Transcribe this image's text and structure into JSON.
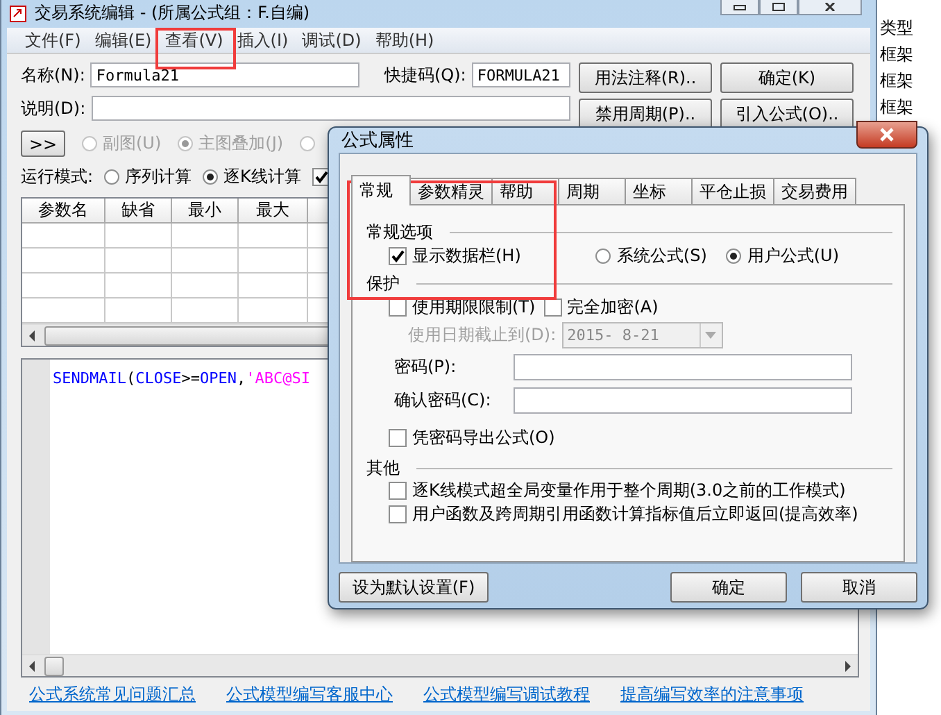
{
  "window": {
    "title": "交易系统编辑 - (所属公式组：F.自编)"
  },
  "menu": [
    {
      "label": "文件(F)"
    },
    {
      "label": "编辑(E)"
    },
    {
      "label": "查看(V)"
    },
    {
      "label": "插入(I)"
    },
    {
      "label": "调试(D)"
    },
    {
      "label": "帮助(H)"
    }
  ],
  "form": {
    "name_label": "名称(N):",
    "name_value": "Formula21",
    "shortcut_label": "快捷码(Q):",
    "shortcut_value": "FORMULA21",
    "desc_label": "说明(D):",
    "buttons": [
      {
        "label": "用法注释(R).."
      },
      {
        "label": "确定(K)"
      },
      {
        "label": "禁用周期(P).."
      },
      {
        "label": "引入公式(O).."
      }
    ]
  },
  "expand_button": ">>",
  "chart_options": [
    {
      "label": "副图(U)",
      "selected": false,
      "disabled": true
    },
    {
      "label": "主图叠加(J)",
      "selected": true,
      "disabled": true
    },
    {
      "selected": false,
      "disabled": true
    }
  ],
  "run_mode": {
    "label": "运行模式:",
    "options": [
      {
        "label": "序列计算",
        "selected": false
      },
      {
        "label": "逐K线计算",
        "selected": true
      }
    ],
    "checkbox": {
      "checked": true
    }
  },
  "params_table": {
    "columns": [
      "参数名",
      "缺省",
      "最小",
      "最大"
    ]
  },
  "editor": {
    "tokens": [
      {
        "text": "SENDMAIL",
        "color": "#0000ff"
      },
      {
        "text": "(",
        "color": "#000000"
      },
      {
        "text": "CLOSE",
        "color": "#0000ff"
      },
      {
        "text": ">=",
        "color": "#000000"
      },
      {
        "text": "OPEN",
        "color": "#0000ff"
      },
      {
        "text": ",",
        "color": "#000000"
      },
      {
        "text": "'ABC@SI",
        "color": "#ff00ff"
      }
    ]
  },
  "links": [
    "公式系统常见问题汇总",
    "公式模型编写客服中心",
    "公式模型编写调试教程",
    "提高编写效率的注意事项"
  ],
  "background_list": {
    "header": "类型",
    "rows": [
      "框架",
      "框架",
      "框架"
    ]
  },
  "dialog": {
    "title": "公式属性",
    "tabs": [
      {
        "label": "常规",
        "selected": true
      },
      {
        "label": "参数精灵",
        "selected": false
      },
      {
        "label": "帮助",
        "selected": false
      },
      {
        "label": "周期",
        "selected": false
      },
      {
        "label": "坐标",
        "selected": false
      },
      {
        "label": "平仓止损",
        "selected": false
      },
      {
        "label": "交易费用",
        "selected": false
      }
    ],
    "general_heading": "常规选项",
    "show_data_bar": {
      "label": "显示数据栏(H)",
      "checked": true
    },
    "formula_type": [
      {
        "label": "系统公式(S)",
        "selected": false
      },
      {
        "label": "用户公式(U)",
        "selected": true
      }
    ],
    "protection_heading": "保护",
    "protection_options": [
      {
        "label": "使用期限限制(T)",
        "checked": false
      },
      {
        "label": "完全加密(A)",
        "checked": false
      }
    ],
    "expiry": {
      "label": "使用日期截止到(D):",
      "value": "2015- 8-21",
      "disabled": true
    },
    "password_label": "密码(P):",
    "confirm_label": "确认密码(C):",
    "export_with_password": {
      "label": "凭密码导出公式(O)",
      "checked": false
    },
    "other_heading": "其他",
    "other_options": [
      {
        "label": "逐K线模式超全局变量作用于整个周期(3.0之前的工作模式)",
        "checked": false
      },
      {
        "label": "用户函数及跨周期引用函数计算指标值后立即返回(提高效率)",
        "checked": false
      }
    ],
    "buttons": [
      {
        "label": "设为默认设置(F)"
      },
      {
        "label": "确定"
      },
      {
        "label": "取消"
      }
    ]
  }
}
